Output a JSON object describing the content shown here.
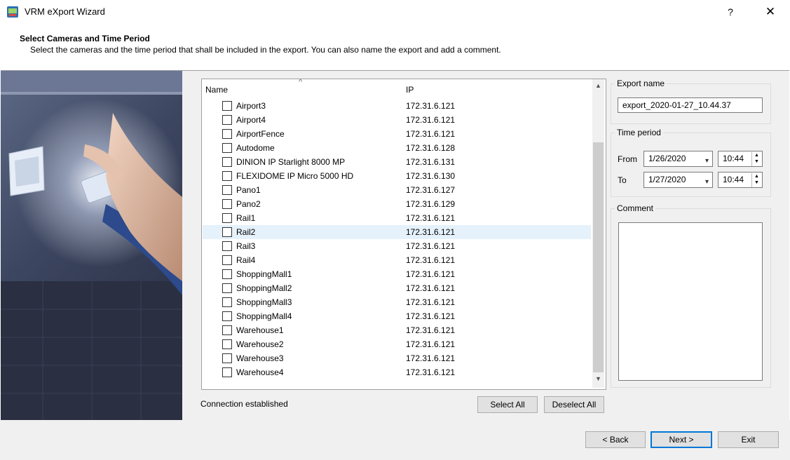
{
  "window": {
    "title": "VRM eXport Wizard",
    "help_label": "?",
    "close_label": "✕"
  },
  "header": {
    "title": "Select Cameras and Time Period",
    "subtitle": "Select the cameras and the time period that shall be included in the export. You can also name the export and add a comment."
  },
  "list": {
    "columns": [
      "Name",
      "IP"
    ],
    "sort_glyph": "^",
    "rows": [
      {
        "name": "Airport3",
        "ip": "172.31.6.121"
      },
      {
        "name": "Airport4",
        "ip": "172.31.6.121"
      },
      {
        "name": "AirportFence",
        "ip": "172.31.6.121"
      },
      {
        "name": "Autodome",
        "ip": "172.31.6.128"
      },
      {
        "name": "DINION IP Starlight 8000 MP",
        "ip": "172.31.6.131"
      },
      {
        "name": "FLEXIDOME IP Micro 5000 HD",
        "ip": "172.31.6.130"
      },
      {
        "name": "Pano1",
        "ip": "172.31.6.127"
      },
      {
        "name": "Pano2",
        "ip": "172.31.6.129"
      },
      {
        "name": "Rail1",
        "ip": "172.31.6.121"
      },
      {
        "name": "Rail2",
        "ip": "172.31.6.121"
      },
      {
        "name": "Rail3",
        "ip": "172.31.6.121"
      },
      {
        "name": "Rail4",
        "ip": "172.31.6.121"
      },
      {
        "name": "ShoppingMall1",
        "ip": "172.31.6.121"
      },
      {
        "name": "ShoppingMall2",
        "ip": "172.31.6.121"
      },
      {
        "name": "ShoppingMall3",
        "ip": "172.31.6.121"
      },
      {
        "name": "ShoppingMall4",
        "ip": "172.31.6.121"
      },
      {
        "name": "Warehouse1",
        "ip": "172.31.6.121"
      },
      {
        "name": "Warehouse2",
        "ip": "172.31.6.121"
      },
      {
        "name": "Warehouse3",
        "ip": "172.31.6.121"
      },
      {
        "name": "Warehouse4",
        "ip": "172.31.6.121"
      }
    ],
    "highlighted_row": "Rail2"
  },
  "status": "Connection established",
  "buttons": {
    "select_all": "Select All",
    "deselect_all": "Deselect All"
  },
  "export": {
    "label": "Export name",
    "value": "export_2020-01-27_10.44.37"
  },
  "time_period": {
    "label": "Time period",
    "from_label": "From",
    "from_date": "1/26/2020",
    "from_time": "10:44",
    "to_label": "To",
    "to_date": "1/27/2020",
    "to_time": "10:44"
  },
  "comment": {
    "label": "Comment",
    "value": ""
  },
  "footer": {
    "back": "< Back",
    "next": "Next >",
    "exit": "Exit"
  },
  "colors": {
    "accent": "#0078d7",
    "selection": "#e5f1fb",
    "panel": "#f0f0f0"
  }
}
